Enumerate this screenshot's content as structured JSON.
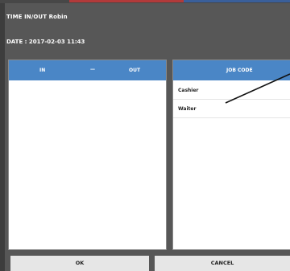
{
  "dialog": {
    "title": "TIME IN/OUT Robin",
    "date": "DATE : 2017-02-03 11:43"
  },
  "timeTable": {
    "in_header": "IN",
    "separator": "—",
    "out_header": "OUT"
  },
  "jobTable": {
    "header": "JOB CODE",
    "rows": [
      "Cashier",
      "Waiter"
    ]
  },
  "buttons": {
    "ok": "OK",
    "cancel": "CANCEL"
  },
  "colors": {
    "header_blue": "#4a86c6",
    "dialog_bg": "#575757",
    "button_bg": "#e6e6e6"
  }
}
